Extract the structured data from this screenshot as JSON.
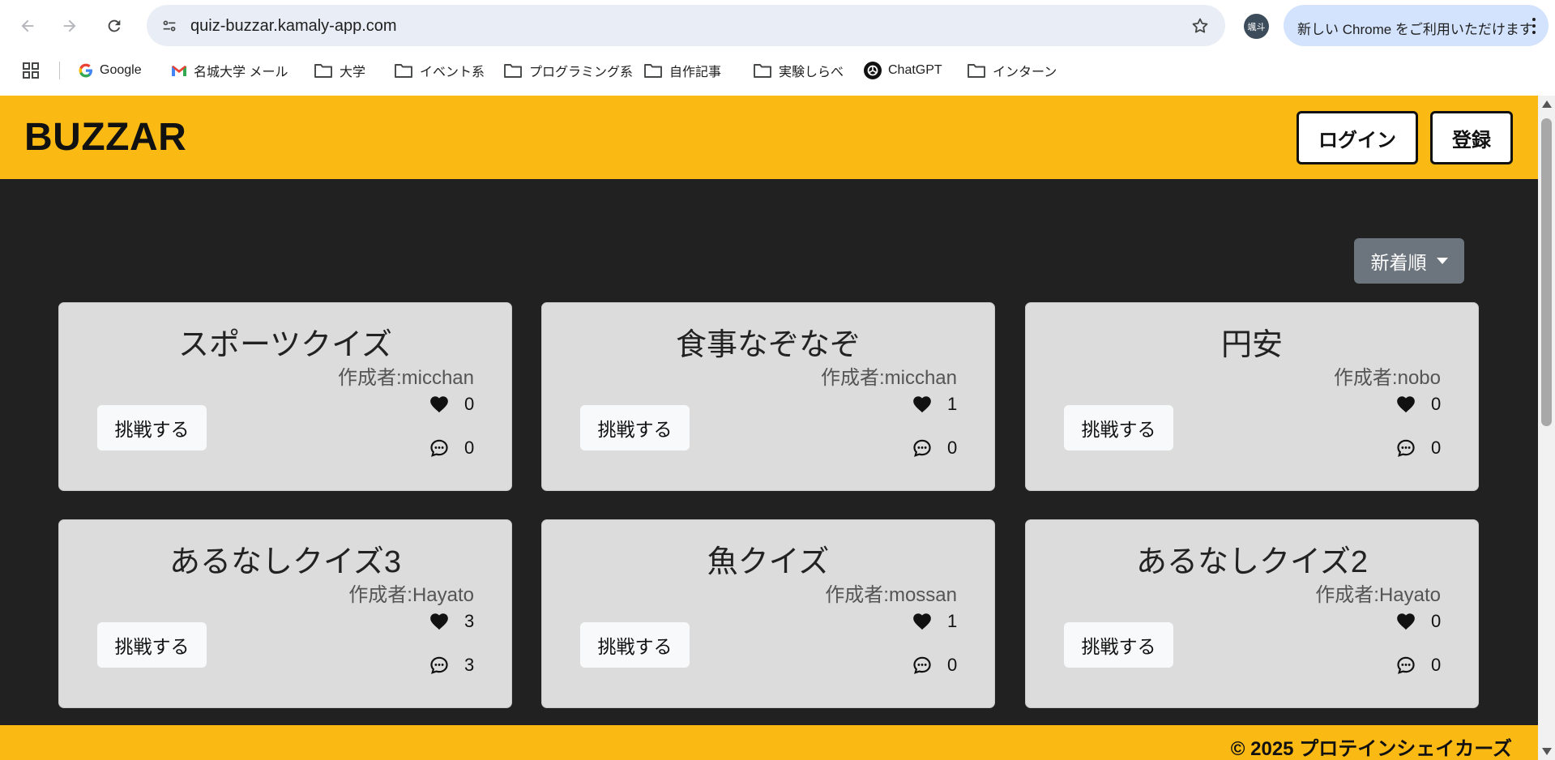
{
  "browser": {
    "url": "quiz-buzzar.kamaly-app.com",
    "profile_initials": "颯斗",
    "update_label": "新しい Chrome をご利用いただけます",
    "bookmarks": [
      {
        "label": "Google",
        "icon": "google-icon"
      },
      {
        "label": "名城大学 メール",
        "icon": "gmail-icon"
      },
      {
        "label": "大学",
        "icon": "folder-icon"
      },
      {
        "label": "イベント系",
        "icon": "folder-icon"
      },
      {
        "label": "プログラミング系",
        "icon": "folder-icon"
      },
      {
        "label": "自作記事",
        "icon": "folder-icon"
      },
      {
        "label": "実験しらべ",
        "icon": "folder-icon"
      },
      {
        "label": "ChatGPT",
        "icon": "chatgpt-icon"
      },
      {
        "label": "インターン",
        "icon": "folder-icon"
      }
    ]
  },
  "header": {
    "logo": "BUZZAR",
    "login_label": "ログイン",
    "register_label": "登録",
    "brand_color": "#fbb914"
  },
  "sort": {
    "label": "新着順"
  },
  "cards": [
    {
      "title": "スポーツクイズ",
      "author": "作成者:micchan",
      "try_label": "挑戦する",
      "likes": "0",
      "comments": "0"
    },
    {
      "title": "食事なぞなぞ",
      "author": "作成者:micchan",
      "try_label": "挑戦する",
      "likes": "1",
      "comments": "0"
    },
    {
      "title": "円安",
      "author": "作成者:nobo",
      "try_label": "挑戦する",
      "likes": "0",
      "comments": "0"
    },
    {
      "title": "あるなしクイズ3",
      "author": "作成者:Hayato",
      "try_label": "挑戦する",
      "likes": "3",
      "comments": "3"
    },
    {
      "title": "魚クイズ",
      "author": "作成者:mossan",
      "try_label": "挑戦する",
      "likes": "1",
      "comments": "0"
    },
    {
      "title": "あるなしクイズ2",
      "author": "作成者:Hayato",
      "try_label": "挑戦する",
      "likes": "0",
      "comments": "0"
    }
  ],
  "footer": {
    "copyright": "© 2025 プロテインシェイカーズ"
  }
}
